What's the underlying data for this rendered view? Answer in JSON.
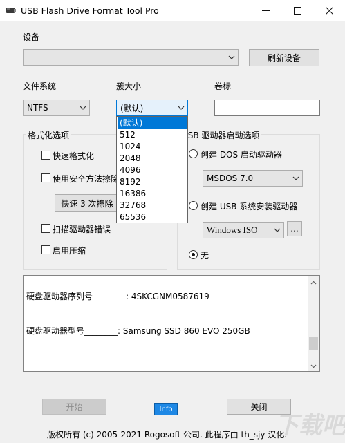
{
  "window": {
    "title": "USB Flash Drive Format Tool Pro",
    "minimize_icon": "minimize-icon",
    "maximize_icon": "maximize-icon",
    "close_icon": "close-icon"
  },
  "device": {
    "label": "设备",
    "selected": "",
    "refresh_label": "刷新设备"
  },
  "filesystem": {
    "label": "文件系统",
    "selected": "NTFS"
  },
  "cluster": {
    "label": "簇大小",
    "selected": "(默认)",
    "options": [
      "(默认)",
      "512",
      "1024",
      "2048",
      "4096",
      "8192",
      "16386",
      "32768",
      "65536"
    ],
    "highlighted_index": 0
  },
  "volume": {
    "label": "卷标",
    "value": ""
  },
  "format_options": {
    "title": "格式化选项",
    "quick_format": "快速格式化",
    "secure_erase": "使用安全方法擦除",
    "erase_button": "快速 3 次擦除",
    "scan_errors": "扫描驱动器错误",
    "enable_compression": "启用压缩"
  },
  "boot_options": {
    "title": "USB 驱动器启动选项",
    "dos_radio": "创建 DOS 启动驱动器",
    "dos_selected": "MSDOS 7.0",
    "usb_radio": "创建 USB 系统安装驱动器",
    "usb_selected": "Windows ISO",
    "browse_label": "...",
    "none_radio": "无"
  },
  "info": {
    "serial_label": "硬盘驱动器序列号________: 4SKCGNM0587619",
    "model_label": "硬盘驱动器型号________: Samsung SSD 860 EVO 250GB"
  },
  "footer": {
    "start_label": "开始",
    "info_label": "Info",
    "close_label": "关闭",
    "copyright": "版权所有 (c) 2005-2021 Rogosoft 公司.   此程序由 th_sjy 汉化.",
    "watermark": "下载吧"
  },
  "colors": {
    "selection": "#0078d7",
    "info_button": "#1e88e5",
    "window_bg": "#f0f0f0"
  }
}
